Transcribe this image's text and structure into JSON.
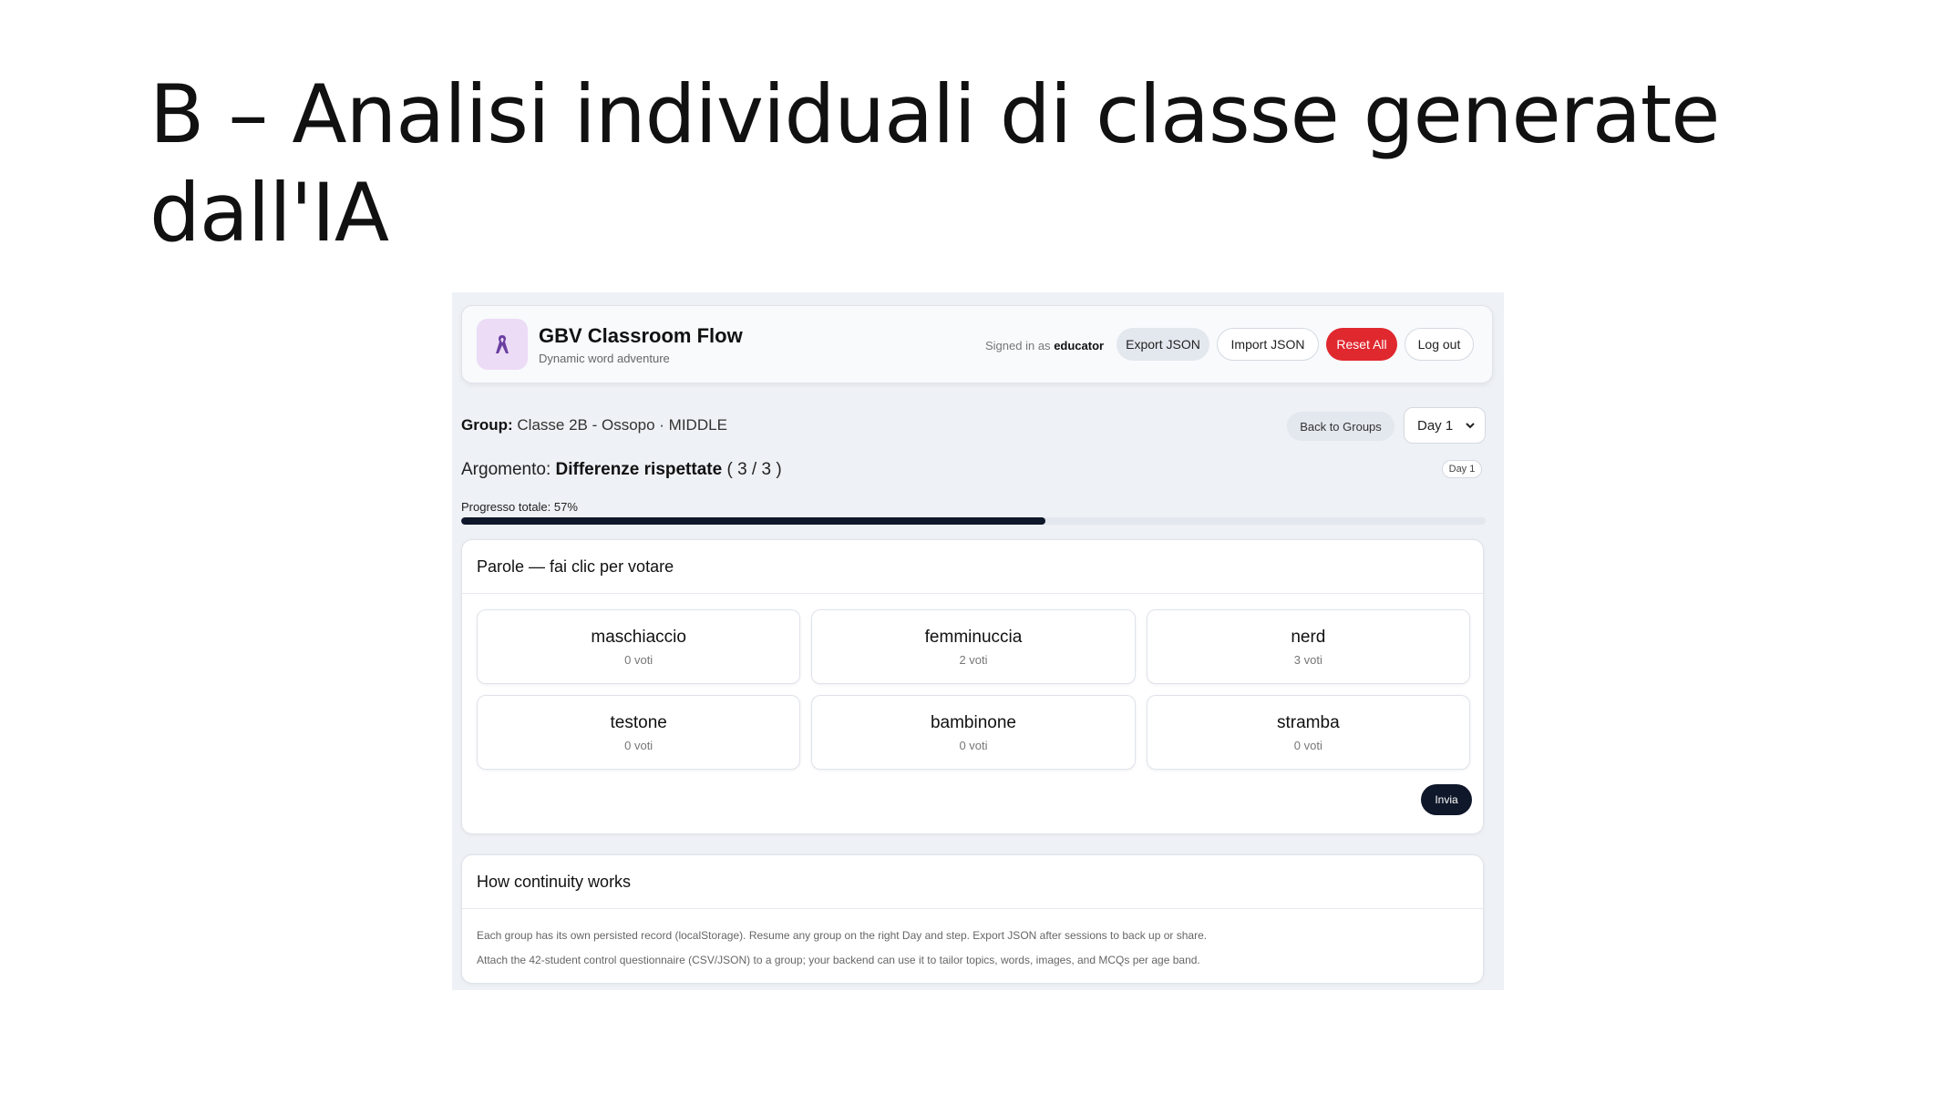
{
  "slide": {
    "title": "B – Analisi individuali di classe generate dall'IA"
  },
  "app": {
    "title": "GBV Classroom Flow",
    "subtitle": "Dynamic word adventure",
    "logo_icon": "ribbon-icon",
    "signed_in_prefix": "Signed in as",
    "signed_in_user": "educator",
    "buttons": {
      "export": "Export JSON",
      "import": "Import JSON",
      "reset": "Reset All",
      "logout": "Log out"
    }
  },
  "group": {
    "label": "Group:",
    "value": "Classe 2B - Ossopo · MIDDLE",
    "back_button": "Back to Groups",
    "day_selected": "Day 1"
  },
  "topic": {
    "label": "Argomento:",
    "name": "Differenze rispettate",
    "counter": "( 3 / 3 )",
    "day_badge": "Day 1"
  },
  "progress": {
    "label": "Progresso totale: 57%",
    "value_percent": 57
  },
  "words_card": {
    "title": "Parole — fai clic per votare",
    "words": [
      {
        "label": "maschiaccio",
        "votes": "0 voti"
      },
      {
        "label": "femminuccia",
        "votes": "2 voti"
      },
      {
        "label": "nerd",
        "votes": "3 voti"
      },
      {
        "label": "testone",
        "votes": "0 voti"
      },
      {
        "label": "bambinone",
        "votes": "0 voti"
      },
      {
        "label": "stramba",
        "votes": "0 voti"
      }
    ],
    "send_button": "Invia"
  },
  "info_card": {
    "title": "How continuity works",
    "lines": [
      "Each group has its own persisted record (localStorage). Resume any group on the right Day and step. Export JSON after sessions to back up or share.",
      "Attach the 42-student control questionnaire (CSV/JSON) to a group; your backend can use it to tailor topics, words, images, and MCQs per age band."
    ]
  },
  "colors": {
    "accent_dark": "#0f172a",
    "danger": "#e0282f",
    "logo_bg": "#ecdcf6",
    "logo_fg": "#6b3fa0"
  }
}
